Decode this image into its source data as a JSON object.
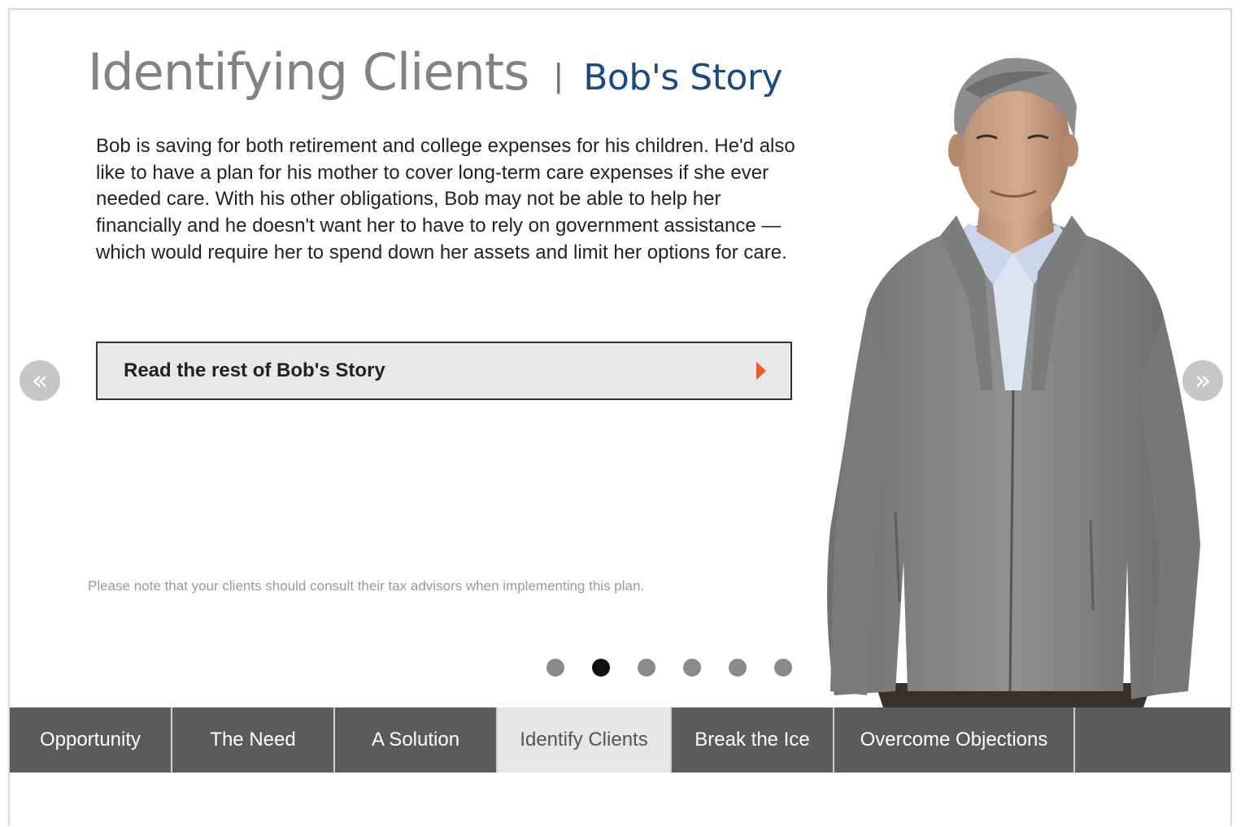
{
  "header": {
    "title": "Identifying Clients",
    "separator": "|",
    "subtitle": "Bob's Story"
  },
  "story": {
    "paragraph": "Bob is saving for both retirement and college expenses for his children. He'd also like to have a plan for his mother to cover long-term care expenses if she ever needed care. With his other obligations, Bob may not be able to help her financially and he doesn't want her to have to rely on government assistance — which would require her to spend down her assets and limit her options for care."
  },
  "cta": {
    "label": "Read the rest of Bob's Story",
    "icon": "play-arrow-icon",
    "arrow_color": "#f05a28"
  },
  "carousel": {
    "prev_label": "«",
    "next_label": "»",
    "slide_count": 6,
    "active_slide": 2
  },
  "note": "Please note that your clients should consult their tax advisors when implementing this plan.",
  "tabs": [
    {
      "label": "Opportunity"
    },
    {
      "label": "The Need"
    },
    {
      "label": "A Solution"
    },
    {
      "label": "Identify Clients",
      "active": true
    },
    {
      "label": "Break the Ice"
    },
    {
      "label": "Overcome Objections"
    }
  ],
  "colors": {
    "title_gray": "#808285",
    "subtitle_blue": "#1a4a84",
    "tabbar": "#5b5b5b",
    "tab_active": "#e6e6e6",
    "accent_orange": "#f05a28"
  }
}
